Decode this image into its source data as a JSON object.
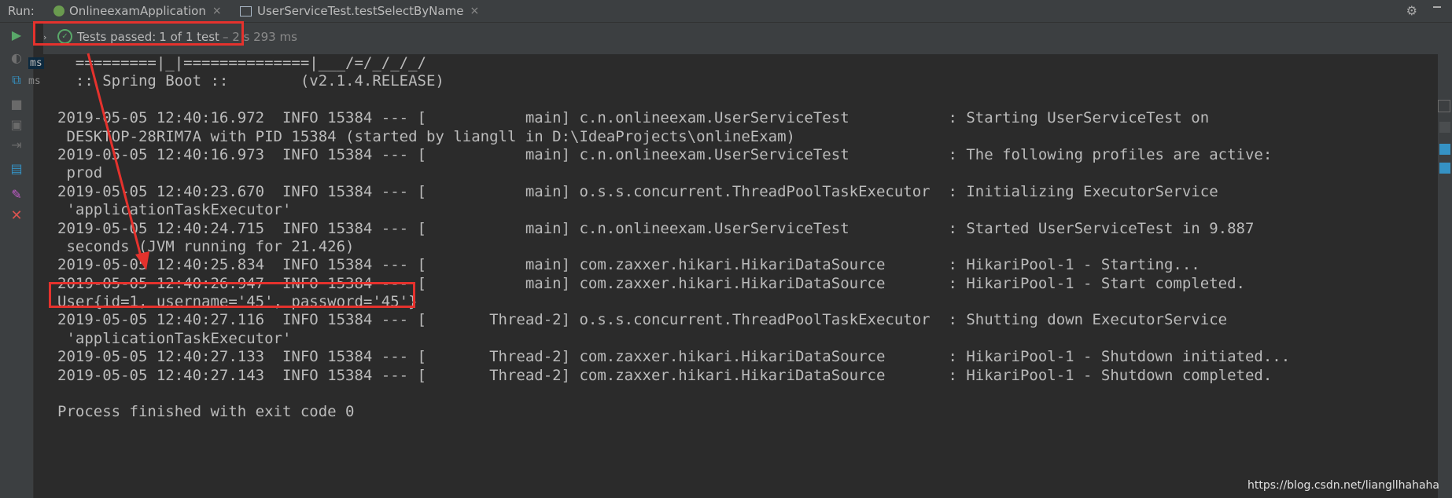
{
  "run_label": "Run:",
  "tabs": [
    {
      "label": "OnlineexamApplication",
      "close": "×"
    },
    {
      "label": "UserServiceTest.testSelectByName",
      "close": "×"
    }
  ],
  "test_status": {
    "chevron": "›",
    "prefix": "Tests passed:",
    "count": "1 of 1 test",
    "duration": "– 2 s 293 ms"
  },
  "ms_labels": [
    "ms",
    "ms"
  ],
  "console_lines": [
    "  =========|_|==============|___/=/_/_/_/",
    "  :: Spring Boot ::        (v2.1.4.RELEASE)",
    "",
    "2019-05-05 12:40:16.972  INFO 15384 --- [           main] c.n.onlineexam.UserServiceTest           : Starting UserServiceTest on",
    " DESKTOP-28RIM7A with PID 15384 (started by liangll in D:\\IdeaProjects\\onlineExam)",
    "2019-05-05 12:40:16.973  INFO 15384 --- [           main] c.n.onlineexam.UserServiceTest           : The following profiles are active:",
    " prod",
    "2019-05-05 12:40:23.670  INFO 15384 --- [           main] o.s.s.concurrent.ThreadPoolTaskExecutor  : Initializing ExecutorService",
    " 'applicationTaskExecutor'",
    "2019-05-05 12:40:24.715  INFO 15384 --- [           main] c.n.onlineexam.UserServiceTest           : Started UserServiceTest in 9.887",
    " seconds (JVM running for 21.426)",
    "2019-05-05 12:40:25.834  INFO 15384 --- [           main] com.zaxxer.hikari.HikariDataSource       : HikariPool-1 - Starting...",
    "2019-05-05 12:40:26.947  INFO 15384 --- [           main] com.zaxxer.hikari.HikariDataSource       : HikariPool-1 - Start completed.",
    "User{id=1, username='45', password='45'}",
    "2019-05-05 12:40:27.116  INFO 15384 --- [       Thread-2] o.s.s.concurrent.ThreadPoolTaskExecutor  : Shutting down ExecutorService",
    " 'applicationTaskExecutor'",
    "2019-05-05 12:40:27.133  INFO 15384 --- [       Thread-2] com.zaxxer.hikari.HikariDataSource       : HikariPool-1 - Shutdown initiated...",
    "2019-05-05 12:40:27.143  INFO 15384 --- [       Thread-2] com.zaxxer.hikari.HikariDataSource       : HikariPool-1 - Shutdown completed.",
    "",
    "Process finished with exit code 0"
  ],
  "watermark": "https://blog.csdn.net/liangllhahaha",
  "colors": {
    "annotation_red": "#e5322d",
    "pass_green": "#59a869",
    "console_bg": "#2b2b2b",
    "panel_bg": "#3c3f41"
  },
  "icons": {
    "tab1": "spring-boot-app-icon",
    "tab2": "test-class-icon",
    "toolbar": [
      "rerun-icon",
      "rerun-failed-icon",
      "toggle-auto-test-icon",
      "stop-icon",
      "dump-threads-icon",
      "exit-icon",
      "layout-icon",
      "pin-icon",
      "close-icon"
    ]
  }
}
